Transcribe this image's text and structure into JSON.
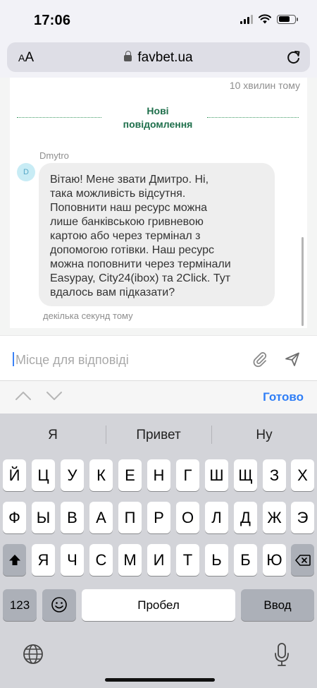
{
  "status_bar": {
    "time": "17:06",
    "icons": [
      "signal-icon",
      "wifi-icon",
      "battery-icon"
    ]
  },
  "browser": {
    "text_size_label_small": "A",
    "text_size_label_large": "A",
    "domain": "favbet.ua",
    "icons": [
      "lock-icon",
      "reload-icon"
    ]
  },
  "chat": {
    "top_timestamp": "10 хвилин тому",
    "new_messages_line1": "Нові",
    "new_messages_line2": "повідомлення",
    "sender": "Dmytro",
    "avatar_letter": "D",
    "message_lines": [
      "Вітаю! Мене звати Дмитро. Ні,",
      "така можливість відсутня.",
      "Поповнити наш ресурс можна",
      "лише банківською гривневою",
      "картою або через термінал з",
      "допомогою готівки. Наш ресурс",
      "можна поповнити через термінали",
      "Easypay, City24(ibox) та 2Click. Тут",
      "вдалось вам підказати?"
    ],
    "message_time": "декілька секунд тому"
  },
  "reply": {
    "placeholder": "Місце для відповіді",
    "icons": [
      "paperclip-icon",
      "send-icon"
    ]
  },
  "accessory": {
    "done_label": "Готово",
    "icons": [
      "chevron-up-icon",
      "chevron-down-icon"
    ]
  },
  "keyboard": {
    "suggestions": [
      "Я",
      "Привет",
      "Ну"
    ],
    "row1": [
      "Й",
      "Ц",
      "У",
      "К",
      "Е",
      "Н",
      "Г",
      "Ш",
      "Щ",
      "З",
      "Х"
    ],
    "row2": [
      "Ф",
      "Ы",
      "В",
      "А",
      "П",
      "Р",
      "О",
      "Л",
      "Д",
      "Ж",
      "Э"
    ],
    "row3": [
      "Я",
      "Ч",
      "С",
      "М",
      "И",
      "Т",
      "Ь",
      "Б",
      "Ю"
    ],
    "numbers_label": "123",
    "space_label": "Пробел",
    "return_label": "Ввод",
    "icons": [
      "shift-icon",
      "backspace-icon",
      "emoji-icon",
      "globe-icon",
      "microphone-icon"
    ]
  }
}
